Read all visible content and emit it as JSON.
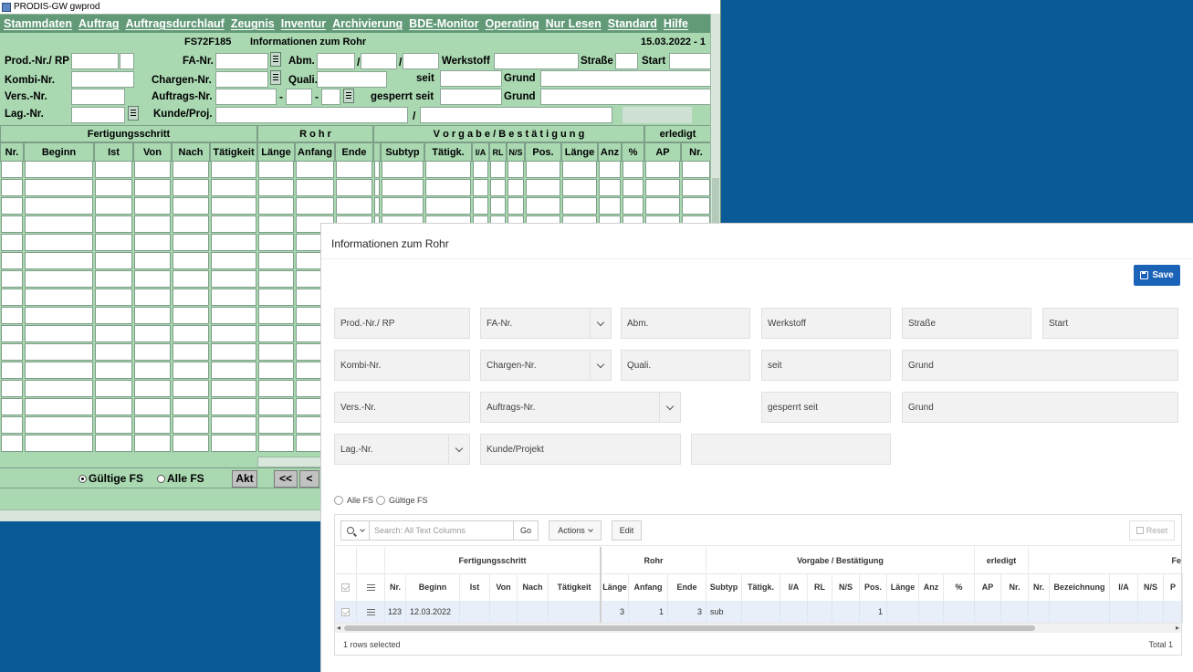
{
  "legacy": {
    "window_title": "PRODIS-GW gwprod",
    "menu": [
      "Stammdaten",
      "Auftrag",
      "Auftragsdurchlauf",
      "Zeugnis",
      "Inventur",
      "Archivierung",
      "BDE-Monitor",
      "Operating",
      "Nur Lesen",
      "Standard",
      "Hilfe"
    ],
    "form_code": "FS72F185",
    "form_title": "Informationen zum Rohr",
    "date": "15.03.2022 - 1",
    "labels": {
      "prod_nr": "Prod.-Nr./ RP",
      "fa_nr": "FA-Nr.",
      "abm": "Abm.",
      "werkstoff": "Werkstoff",
      "strasse": "Straße",
      "start": "Start",
      "kombi_nr": "Kombi-Nr.",
      "chargen_nr": "Chargen-Nr.",
      "quali": "Quali.",
      "seit": "seit",
      "grund": "Grund",
      "vers_nr": "Vers.-Nr.",
      "auftrags_nr": "Auftrags-Nr.",
      "gesperrt_seit": "gesperrt seit",
      "grund2": "Grund",
      "lag_nr": "Lag.-Nr.",
      "kunde_proj": "Kunde/Proj."
    },
    "grid_groups": [
      "Fertigungsschritt",
      "R o h r",
      "V o r g a b e  /  B e s t ä t i g u n g",
      "erledigt"
    ],
    "grid_columns": [
      "Nr.",
      "Beginn",
      "Ist",
      "Von",
      "Nach",
      "Tätigkeit",
      "Länge",
      "Anfang",
      "Ende",
      "Subtyp",
      "Tätigk.",
      "I/A",
      "RL",
      "N/S",
      "Pos.",
      "Länge",
      "Anz",
      "%",
      "AP",
      "Nr."
    ],
    "radio_gueltige": "Gültige FS",
    "radio_alle": "Alle FS",
    "btn_akt": "Akt",
    "btn_first": "<<",
    "btn_prev": "<"
  },
  "dialog": {
    "title": "Informationen zum Rohr",
    "save_label": "Save",
    "fields": {
      "prod_nr": "Prod.-Nr./ RP",
      "fa_nr": "FA-Nr.",
      "abm": "Abm.",
      "werkstoff": "Werkstoff",
      "strasse": "Straße",
      "start": "Start",
      "kombi_nr": "Kombi-Nr.",
      "chargen_nr": "Chargen-Nr.",
      "quali": "Quali.",
      "seit": "seit",
      "grund": "Grund",
      "vers_nr": "Vers.-Nr.",
      "auftrags_nr": "Auftrags-Nr.",
      "gesperrt_seit": "gesperrt seit",
      "grund2": "Grund",
      "lag_nr": "Lag.-Nr.",
      "kunde_projekt": "Kunde/Projekt"
    },
    "radio_alle": "Alle FS",
    "radio_gueltige": "Gültige FS",
    "search_placeholder": "Search: All Text Columns",
    "go_label": "Go",
    "actions_label": "Actions",
    "edit_label": "Edit",
    "reset_label": "Reset",
    "groups": [
      "Fertigungsschritt",
      "Rohr",
      "Vorgabe / Bestätigung",
      "erledigt",
      "Fe"
    ],
    "columns": [
      "Nr.",
      "Beginn",
      "Ist",
      "Von",
      "Nach",
      "Tätigkeit",
      "Länge",
      "Anfang",
      "Ende",
      "Subtyp",
      "Tätigk.",
      "I/A",
      "RL",
      "N/S",
      "Pos.",
      "Länge",
      "Anz",
      "%",
      "AP",
      "Nr.",
      "Nr.",
      "Bezeichnung",
      "I/A",
      "N/S",
      "P"
    ],
    "row": {
      "nr": "123",
      "beginn": "12.03.2022",
      "laenge": "3",
      "anfang": "1",
      "ende": "3",
      "subtyp": "sub",
      "pos": "1"
    },
    "footer_selected": "1 rows selected",
    "footer_total": "Total 1"
  }
}
